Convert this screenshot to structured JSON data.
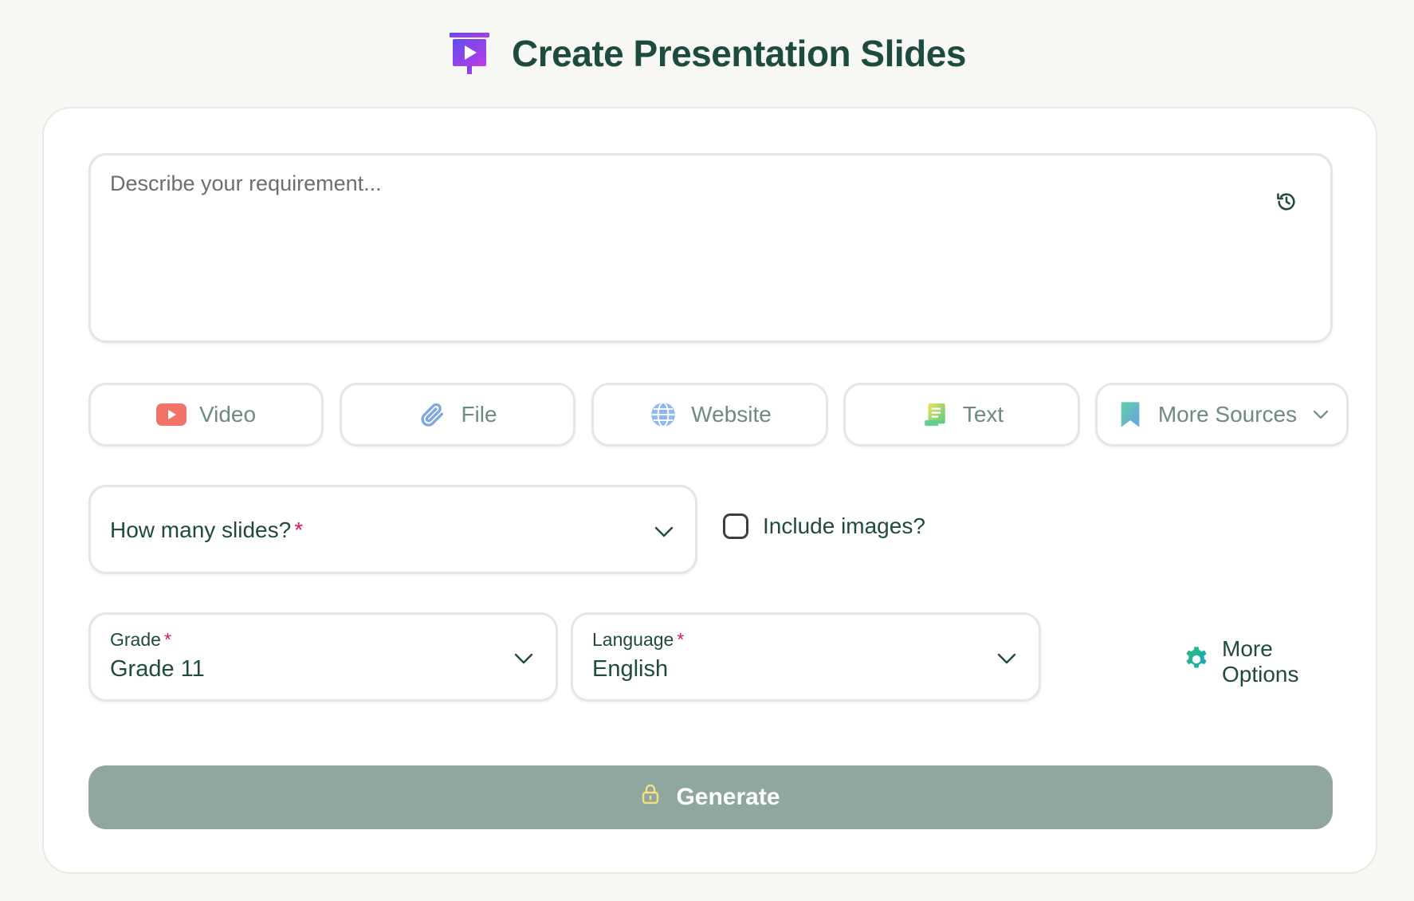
{
  "header": {
    "title": "Create Presentation Slides",
    "logo_icon": "presentation-play-icon"
  },
  "prompt": {
    "placeholder": "Describe your requirement...",
    "value": "",
    "history_icon": "history-icon"
  },
  "sources": {
    "items": [
      {
        "label": "Video",
        "icon": "youtube-icon"
      },
      {
        "label": "File",
        "icon": "paperclip-icon"
      },
      {
        "label": "Website",
        "icon": "globe-icon"
      },
      {
        "label": "Text",
        "icon": "text-document-icon"
      },
      {
        "label": "More Sources",
        "icon": "bookmark-icon"
      }
    ]
  },
  "slides_select": {
    "label": "How many slides?",
    "required_mark": "*"
  },
  "include_images": {
    "label": "Include images?",
    "checked": false
  },
  "grade_select": {
    "label": "Grade",
    "required_mark": "*",
    "value": "Grade 11"
  },
  "language_select": {
    "label": "Language",
    "required_mark": "*",
    "value": "English"
  },
  "more_options": {
    "label": "More Options",
    "icon": "gear-icon"
  },
  "generate": {
    "label": "Generate",
    "icon": "lock-icon"
  },
  "colors": {
    "background": "#f7f8f4",
    "primary_text": "#1f4a3f",
    "required": "#d61b4b",
    "generate_bg": "#90a6a1",
    "logo_purple": "#7b3fe4"
  }
}
